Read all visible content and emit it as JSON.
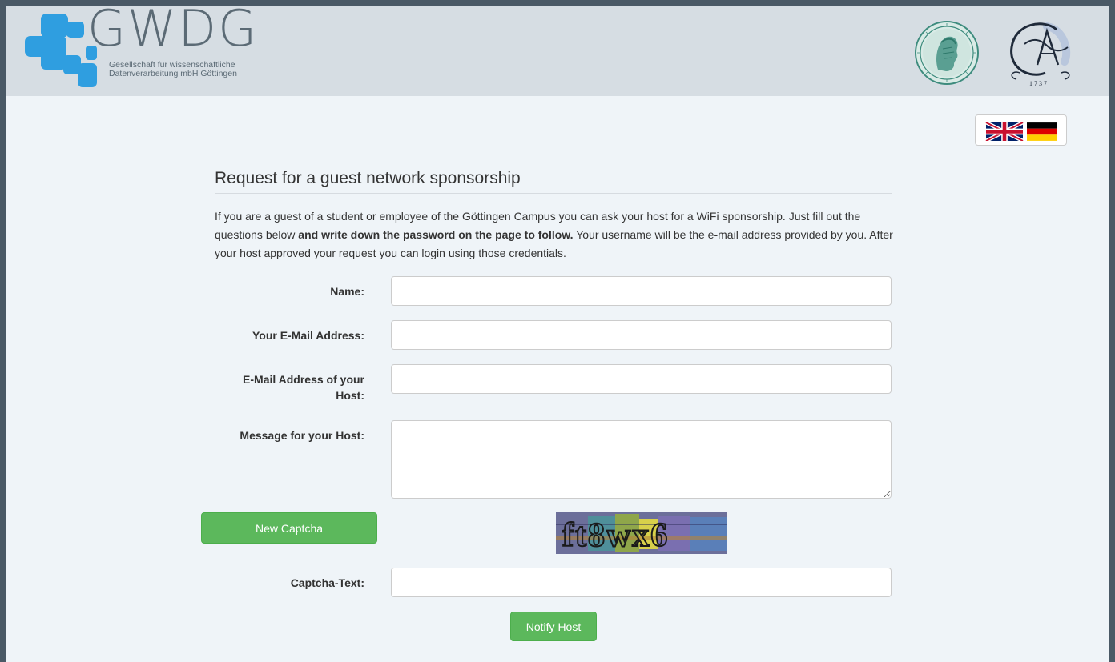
{
  "header": {
    "logo_text": "GWDG",
    "logo_sub_line1": "Gesellschaft für wissenschaftliche",
    "logo_sub_line2": "Datenverarbeitung mbH Göttingen",
    "uni_seal_year": "1 7 3 7"
  },
  "language": {
    "options": [
      "English",
      "Deutsch"
    ]
  },
  "form": {
    "title": "Request for a guest network sponsorship",
    "intro_part1": "If you are a guest of a student or employee of the Göttingen Campus you can ask your host for a WiFi sponsorship. Just fill out the questions below ",
    "intro_bold": "and write down the password on the page to follow.",
    "intro_part2": " Your username will be the e-mail address provided by you. After your host approved your request you can login using those credentials.",
    "name_label": "Name:",
    "name_value": "",
    "email_label": "Your E-Mail Address:",
    "email_value": "",
    "host_email_label_line1": "E-Mail Address of your",
    "host_email_label_line2": "Host:",
    "host_email_value": "",
    "message_label": "Message for your Host:",
    "message_value": "",
    "new_captcha_button": "New Captcha",
    "captcha_text_shown": "ft8wx6",
    "captcha_label": "Captcha-Text:",
    "captcha_value": "",
    "submit_button": "Notify Host"
  },
  "colors": {
    "header_bg": "#d6dde3",
    "page_bg": "#eff4f8",
    "logo_blue": "#2f9ee0",
    "button_green": "#5cb85c",
    "frame": "#4a5966"
  }
}
